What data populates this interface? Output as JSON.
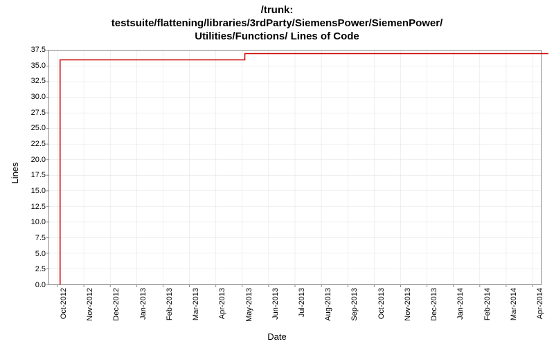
{
  "chart_data": {
    "type": "line",
    "title": "/trunk: testsuite/flattening/libraries/3rdParty/SiemensPower/SiemenPower/Utilities/Functions/ Lines of Code",
    "title_lines": [
      "/trunk:",
      "testsuite/flattening/libraries/3rdParty/SiemensPower/SiemenPower/",
      "Utilities/Functions/ Lines of Code"
    ],
    "xlabel": "Date",
    "ylabel": "Lines",
    "ylim": [
      0,
      37.5
    ],
    "yticks": [
      0.0,
      2.5,
      5.0,
      7.5,
      10.0,
      12.5,
      15.0,
      17.5,
      20.0,
      22.5,
      25.0,
      27.5,
      30.0,
      32.5,
      35.0,
      37.5
    ],
    "xticks": [
      "Oct-2012",
      "Nov-2012",
      "Dec-2012",
      "Jan-2013",
      "Feb-2013",
      "Mar-2013",
      "Apr-2013",
      "May-2013",
      "Jun-2013",
      "Jul-2013",
      "Aug-2013",
      "Sep-2013",
      "Oct-2013",
      "Nov-2013",
      "Dec-2013",
      "Jan-2014",
      "Feb-2014",
      "Mar-2014",
      "Apr-2014"
    ],
    "series": [
      {
        "name": "Lines of Code",
        "color": "#cc0000",
        "points": [
          {
            "x_index": 0.1,
            "y": 0
          },
          {
            "x_index": 0.1,
            "y": 36
          },
          {
            "x_index": 7.1,
            "y": 36
          },
          {
            "x_index": 7.1,
            "y": 37
          },
          {
            "x_index": 18.6,
            "y": 37
          }
        ]
      }
    ]
  }
}
